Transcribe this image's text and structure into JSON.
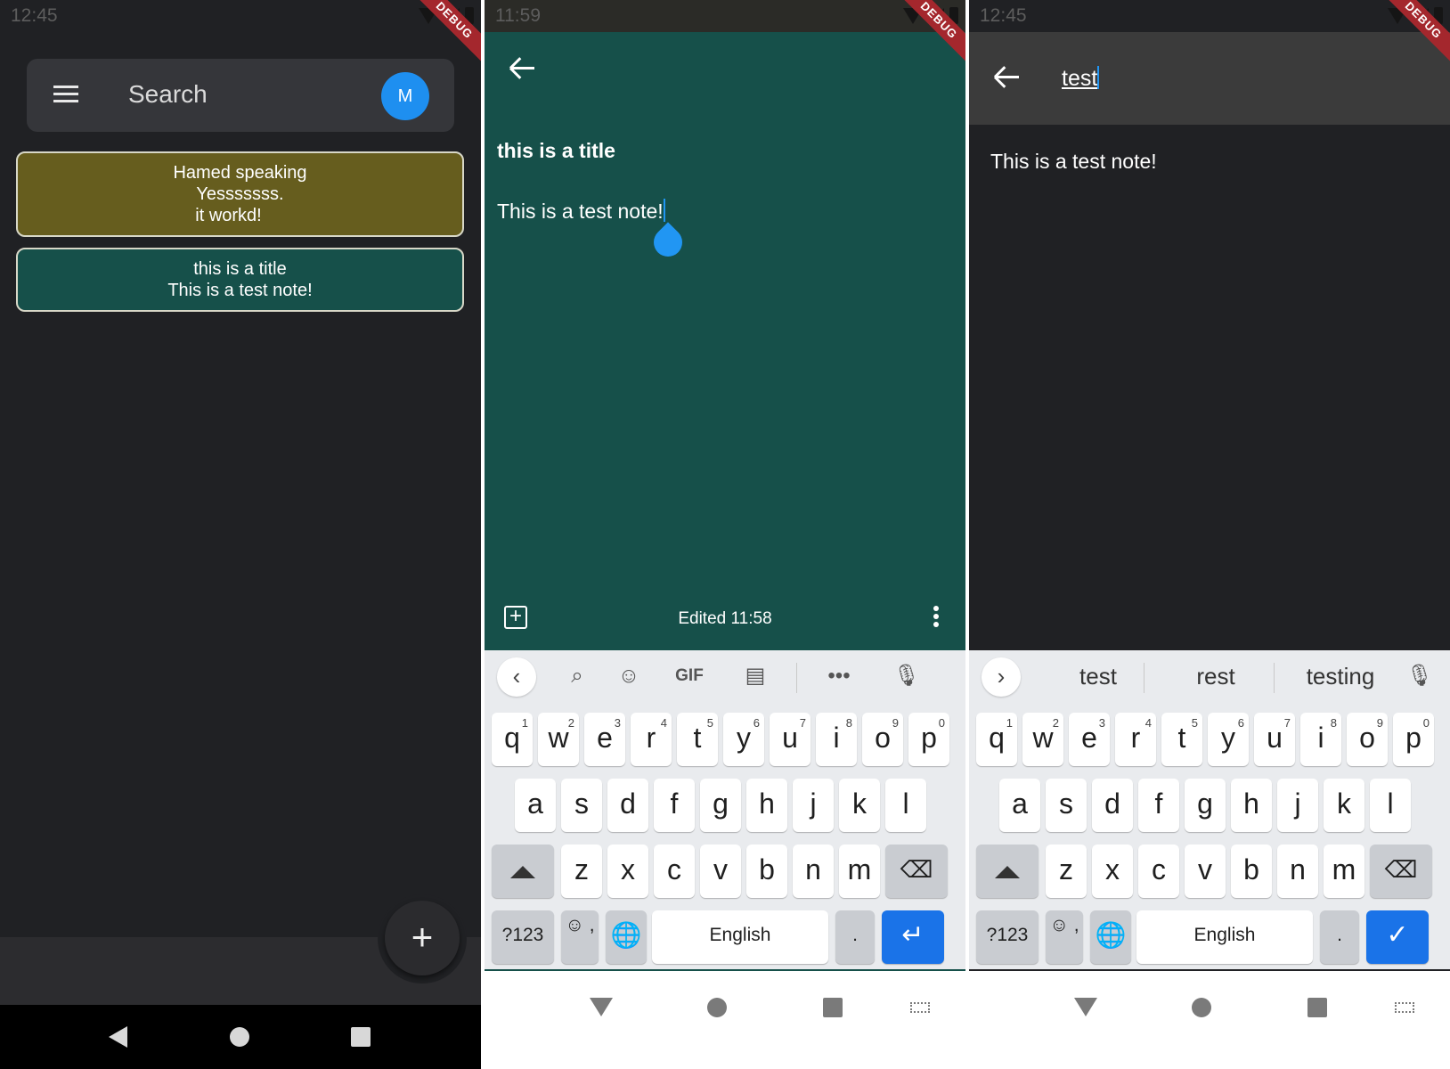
{
  "left_screen": {
    "status_time": "12:45",
    "debug_banner": "DEBUG",
    "search": {
      "placeholder": "Search",
      "avatar_letter": "M",
      "accent": "#1e8ff0"
    },
    "notes": [
      {
        "lines": [
          "Hamed speaking",
          "Yesssssss.",
          "it workd!"
        ],
        "color": "#665d1e"
      },
      {
        "lines": [
          "this is a title",
          "This is a test note!"
        ],
        "color": "#16504a"
      }
    ],
    "fab_label": "+"
  },
  "middle_screen": {
    "status_time": "11:59",
    "debug_banner": "DEBUG",
    "note_title": "this is a title",
    "note_body": "This is a test note!",
    "edited": "Edited 11:58",
    "background": "#16504a",
    "keyboard": {
      "toolbar_icons": [
        "collapse-icon",
        "search-icon",
        "sticker-icon",
        "gif-icon",
        "clipboard-icon",
        "more-icon",
        "mic-icon"
      ],
      "gif_label": "GIF",
      "rows": [
        [
          {
            "k": "q",
            "n": "1"
          },
          {
            "k": "w",
            "n": "2"
          },
          {
            "k": "e",
            "n": "3"
          },
          {
            "k": "r",
            "n": "4"
          },
          {
            "k": "t",
            "n": "5"
          },
          {
            "k": "y",
            "n": "6"
          },
          {
            "k": "u",
            "n": "7"
          },
          {
            "k": "i",
            "n": "8"
          },
          {
            "k": "o",
            "n": "9"
          },
          {
            "k": "p",
            "n": "0"
          }
        ],
        [
          "a",
          "s",
          "d",
          "f",
          "g",
          "h",
          "j",
          "k",
          "l"
        ],
        [
          "z",
          "x",
          "c",
          "v",
          "b",
          "n",
          "m"
        ]
      ],
      "symbols_label": "?123",
      "emoji_label": "☺ ,",
      "space_label": "English",
      "period_label": ".",
      "action": "enter"
    }
  },
  "right_screen": {
    "status_time": "12:45",
    "debug_banner": "DEBUG",
    "query": "test",
    "result": "This is a test note!",
    "keyboard": {
      "suggestions": [
        "test",
        "rest",
        "testing"
      ],
      "symbols_label": "?123",
      "emoji_label": "☺ ,",
      "space_label": "English",
      "period_label": ".",
      "action": "done"
    }
  }
}
